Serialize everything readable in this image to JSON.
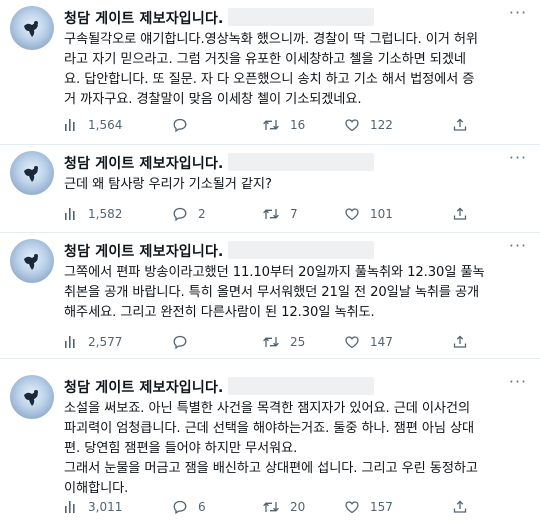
{
  "tweets": [
    {
      "author": "청담 게이트 제보자입니다.",
      "lines": [
        "구속될각오로 얘기합니다.영상녹화 했으니까. 경찰이 딱 그럽니다. 이거 허위",
        "라고 자기 믿으라고. 그럼 거짓을 유포한 이세창하고 첼을 기소하면 되겠네",
        "요. 답안합니다. 또 질문. 자 다 오픈했으니 송치 하고 기소 해서 법정에서 증",
        "거 까자구요. 경찰말이 맞음 이세창 첼이 기소되겠네요."
      ],
      "views": "1,564",
      "replies": "",
      "retweets": "16",
      "likes": "122"
    },
    {
      "author": "청담 게이트 제보자입니다.",
      "lines": [
        "근데 왜 탐사랑 우리가 기소될거 같지?"
      ],
      "views": "1,582",
      "replies": "2",
      "retweets": "7",
      "likes": "101"
    },
    {
      "author": "청담 게이트 제보자입니다.",
      "lines": [
        "그쪽에서 편파 방송이라고했던 11.10부터 20일까지 풀녹취와 12.30일 풀녹",
        "취본을 공개 바랍니다. 특히 올면서 무서워했던 21일 전 20일날 녹취를 공개",
        "해주세요. 그리고 완전히 다른사람이 된 12.30일 녹취도."
      ],
      "views": "2,577",
      "replies": "",
      "retweets": "25",
      "likes": "147"
    },
    {
      "author": "청담 게이트 제보자입니다.",
      "lines": [
        "소설을 써보죠. 아닌 특별한 사건을 목격한 잼지자가 있어요. 근데 이사건의",
        "파괴력이 엄청큽니다. 근데 선택을 해야하는거죠. 둘중 하나. 잼편 아님 상대",
        "편. 당연힘 잼편을 들어야 하지만 무서워요.",
        "그래서 눈물을 머금고 잼을 배신하고 상대편에 섭니다. 그리고 우린 동정하고",
        "이해합니다."
      ],
      "views": "3,011",
      "replies": "6",
      "retweets": "20",
      "likes": "157"
    }
  ],
  "colors": {
    "text": "#0f1419",
    "muted": "#536471",
    "divider": "#e6ecf0"
  },
  "icons": [
    "avatar-image",
    "more-icon",
    "views-icon",
    "reply-icon",
    "retweet-icon",
    "like-icon",
    "share-icon"
  ]
}
